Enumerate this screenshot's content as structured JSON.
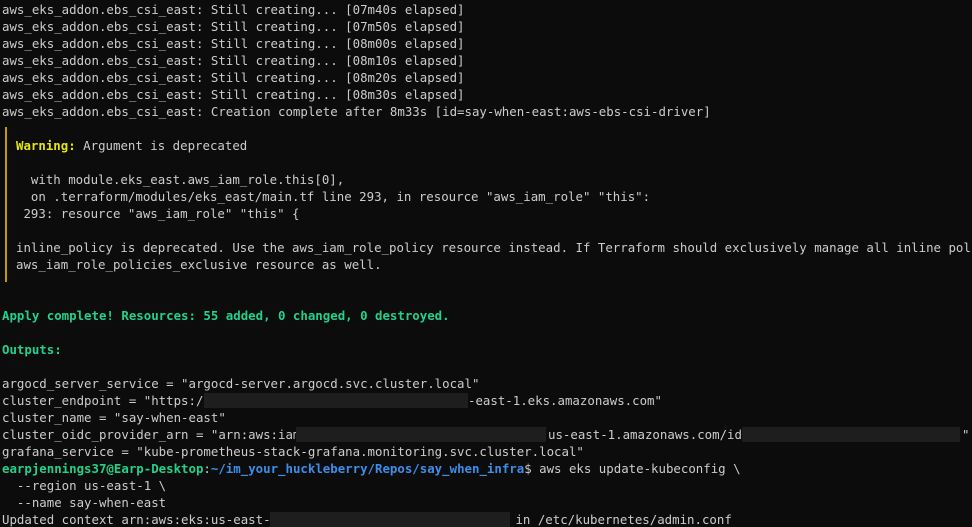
{
  "terminal": {
    "creating_lines": [
      "aws_eks_addon.ebs_csi_east: Still creating... [07m40s elapsed]",
      "aws_eks_addon.ebs_csi_east: Still creating... [07m50s elapsed]",
      "aws_eks_addon.ebs_csi_east: Still creating... [08m00s elapsed]",
      "aws_eks_addon.ebs_csi_east: Still creating... [08m10s elapsed]",
      "aws_eks_addon.ebs_csi_east: Still creating... [08m20s elapsed]",
      "aws_eks_addon.ebs_csi_east: Still creating... [08m30s elapsed]"
    ],
    "complete_line": "aws_eks_addon.ebs_csi_east: Creation complete after 8m33s [id=say-when-east:aws-ebs-csi-driver]",
    "warning": {
      "label": "Warning:",
      "message": " Argument is deprecated",
      "ctx1": "  with module.eks_east.aws_iam_role.this[0],",
      "ctx2": "  on .terraform/modules/eks_east/main.tf line 293, in resource \"aws_iam_role\" \"this\":",
      "ctx3": " 293: resource \"aws_iam_role\" \"this\" {",
      "detail1": "inline_policy is deprecated. Use the aws_iam_role_policy resource instead. If Terraform should exclusively manage all inline policy associations",
      "detail2": "aws_iam_role_policies_exclusive resource as well."
    },
    "apply_complete": "Apply complete! Resources: 55 added, 0 changed, 0 destroyed.",
    "outputs_label": "Outputs:",
    "outputs": {
      "argocd": "argocd_server_service = \"argocd-server.argocd.svc.cluster.local\"",
      "endpoint_prefix": "cluster_endpoint = \"https://",
      "endpoint_suffix": "-east-1.eks.amazonaws.com\"",
      "cluster_name": "cluster_name = \"say-when-east\"",
      "oidc_prefix": "cluster_oidc_provider_arn = \"arn:aws:iam::",
      "oidc_middle": "us-east-1.amazonaws.com/id/",
      "oidc_suffix": "\"",
      "grafana": "grafana_service = \"kube-prometheus-stack-grafana.monitoring.svc.cluster.local\""
    },
    "prompt": {
      "user_host": "earpjennings37@Earp-Desktop",
      "colon": ":",
      "path": "~/im_your_huckleberry/Repos/say_when_infra",
      "dollar": "$",
      "command": " aws eks update-kubeconfig \\",
      "arg1": "  --region us-east-1 \\",
      "arg2": "  --name say-when-east"
    },
    "updated_prefix": "Updated context arn:aws:eks:us-east-1:",
    "updated_suffix": " in /etc/kubernetes/admin.conf"
  }
}
